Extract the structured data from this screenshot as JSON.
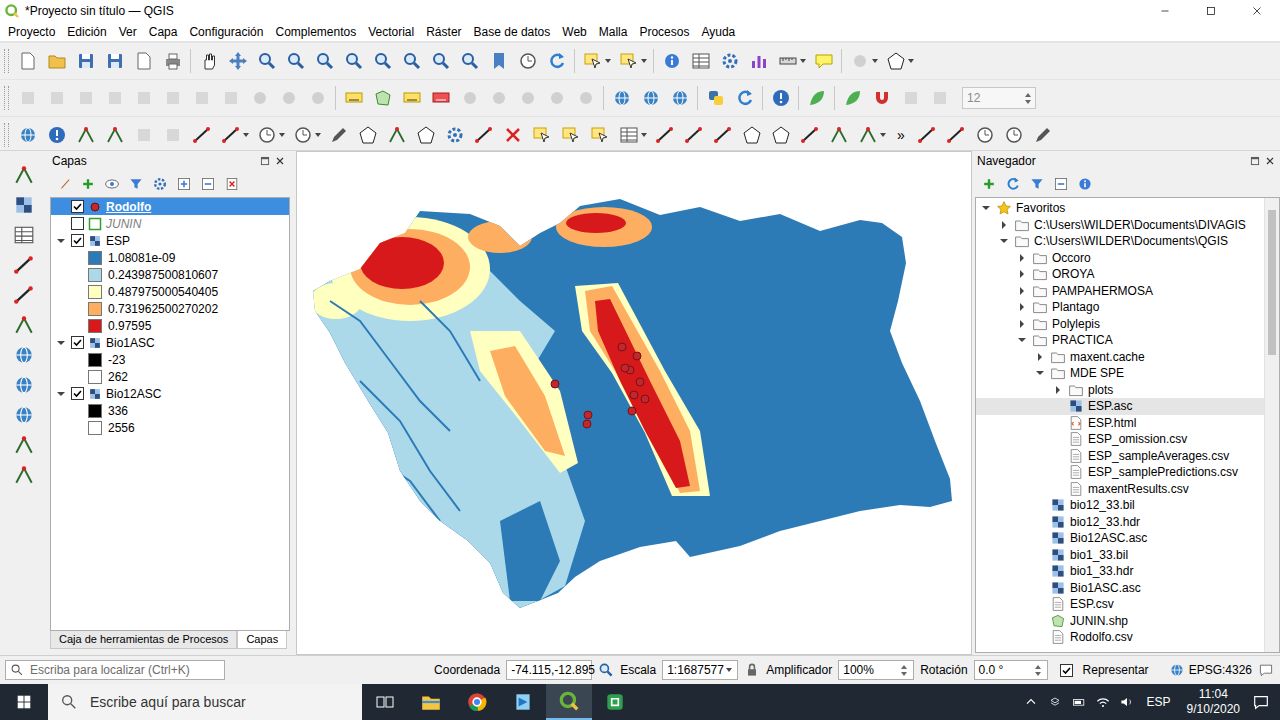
{
  "window": {
    "title": "*Proyecto sin título — QGIS"
  },
  "menu": [
    "Proyecto",
    "Edición",
    "Ver",
    "Capa",
    "Configuración",
    "Complementos",
    "Vectorial",
    "Ráster",
    "Base de datos",
    "Web",
    "Malla",
    "Procesos",
    "Ayuda"
  ],
  "toolbar": {
    "font_size": "12",
    "overflow": "»"
  },
  "layers_panel": {
    "title": "Capas",
    "layers": [
      {
        "name": "Rodolfo",
        "kind": "point",
        "checked": true,
        "selected": true,
        "color": "#c0282d"
      },
      {
        "name": "JUNIN",
        "kind": "polygon",
        "checked": false,
        "selected": false,
        "color": "#33a02c"
      },
      {
        "name": "ESP",
        "kind": "raster",
        "checked": true,
        "selected": false,
        "expanded": true,
        "legend": [
          {
            "label": "1.08081e-09",
            "color": "#2c7bb6"
          },
          {
            "label": "0.243987500810607",
            "color": "#abd9e9"
          },
          {
            "label": "0.487975000540405",
            "color": "#ffffbf"
          },
          {
            "label": "0.731962500270202",
            "color": "#fdae61"
          },
          {
            "label": "0.97595",
            "color": "#d7191c"
          }
        ]
      },
      {
        "name": "Bio1ASC",
        "kind": "raster",
        "checked": true,
        "selected": false,
        "expanded": true,
        "legend": [
          {
            "label": "-23",
            "color": "#000000"
          },
          {
            "label": "262",
            "color": "#ffffff"
          }
        ]
      },
      {
        "name": "Bio12ASC",
        "kind": "raster",
        "checked": true,
        "selected": false,
        "expanded": true,
        "legend": [
          {
            "label": "336",
            "color": "#000000"
          },
          {
            "label": "2556",
            "color": "#ffffff"
          }
        ]
      }
    ],
    "tabs": [
      {
        "label": "Caja de herramientas de Procesos",
        "selected": false
      },
      {
        "label": "Capas",
        "selected": true
      }
    ]
  },
  "browser_panel": {
    "title": "Navegador",
    "tree": [
      {
        "label": "Favoritos",
        "kind": "favorites",
        "expanded": true,
        "selected": false,
        "children": [
          {
            "label": "C:\\Users\\WILDER\\Documents\\DIVAGIS",
            "kind": "folder",
            "expanded": false,
            "selected": false
          },
          {
            "label": "C:\\Users\\WILDER\\Documents\\QGIS",
            "kind": "folder",
            "expanded": true,
            "selected": false,
            "children": [
              {
                "label": "Occoro",
                "kind": "folder",
                "expanded": false,
                "selected": false
              },
              {
                "label": "OROYA",
                "kind": "folder",
                "expanded": false,
                "selected": false
              },
              {
                "label": "PAMPAHERMOSA",
                "kind": "folder",
                "expanded": false,
                "selected": false
              },
              {
                "label": "Plantago",
                "kind": "folder",
                "expanded": false,
                "selected": false
              },
              {
                "label": "Polylepis",
                "kind": "folder",
                "expanded": false,
                "selected": false
              },
              {
                "label": "PRACTICA",
                "kind": "folder",
                "expanded": true,
                "selected": false,
                "children": [
                  {
                    "label": "maxent.cache",
                    "kind": "folder",
                    "expanded": false,
                    "selected": false
                  },
                  {
                    "label": "MDE SPE",
                    "kind": "folder",
                    "expanded": true,
                    "selected": false,
                    "children": [
                      {
                        "label": "plots",
                        "kind": "folder",
                        "expanded": false,
                        "selected": false
                      },
                      {
                        "label": "ESP.asc",
                        "kind": "raster",
                        "selected": true
                      },
                      {
                        "label": "ESP.html",
                        "kind": "html",
                        "selected": false
                      },
                      {
                        "label": "ESP_omission.csv",
                        "kind": "csv",
                        "selected": false
                      },
                      {
                        "label": "ESP_sampleAverages.csv",
                        "kind": "csv",
                        "selected": false
                      },
                      {
                        "label": "ESP_samplePredictions.csv",
                        "kind": "csv",
                        "selected": false
                      },
                      {
                        "label": "maxentResults.csv",
                        "kind": "csv",
                        "selected": false
                      }
                    ]
                  },
                  {
                    "label": "bio12_33.bil",
                    "kind": "raster",
                    "selected": false
                  },
                  {
                    "label": "bio12_33.hdr",
                    "kind": "raster",
                    "selected": false
                  },
                  {
                    "label": "Bio12ASC.asc",
                    "kind": "raster",
                    "selected": false
                  },
                  {
                    "label": "bio1_33.bil",
                    "kind": "raster",
                    "selected": false
                  },
                  {
                    "label": "bio1_33.hdr",
                    "kind": "raster",
                    "selected": false
                  },
                  {
                    "label": "Bio1ASC.asc",
                    "kind": "raster",
                    "selected": false
                  },
                  {
                    "label": "ESP.csv",
                    "kind": "csv",
                    "selected": false
                  },
                  {
                    "label": "JUNIN.shp",
                    "kind": "vector",
                    "selected": false
                  },
                  {
                    "label": "Rodolfo.csv",
                    "kind": "csv",
                    "selected": false
                  }
                ]
              }
            ]
          }
        ]
      }
    ]
  },
  "status_bar": {
    "search_placeholder": "Escriba para localizar (Ctrl+K)",
    "coordinate_label": "Coordenada",
    "coordinate": "-74.115,-12.895",
    "scale_label": "Escala",
    "scale": "1:1687577",
    "magnifier_label": "Amplificador",
    "magnifier": "100%",
    "rotation_label": "Rotación",
    "rotation": "0.0 °",
    "render_label": "Representar",
    "render_checked": true,
    "crs": "EPSG:4326"
  },
  "taskbar": {
    "search_placeholder": "Escribe aquí para buscar",
    "apps": [
      {
        "kind": "explorer",
        "selected": false
      },
      {
        "kind": "chrome",
        "selected": false
      },
      {
        "kind": "appblue",
        "selected": false
      },
      {
        "kind": "qgis",
        "selected": true
      },
      {
        "kind": "appgreen",
        "selected": false
      }
    ],
    "language": "ESP",
    "time": "11:04",
    "date": "9/10/2020"
  }
}
